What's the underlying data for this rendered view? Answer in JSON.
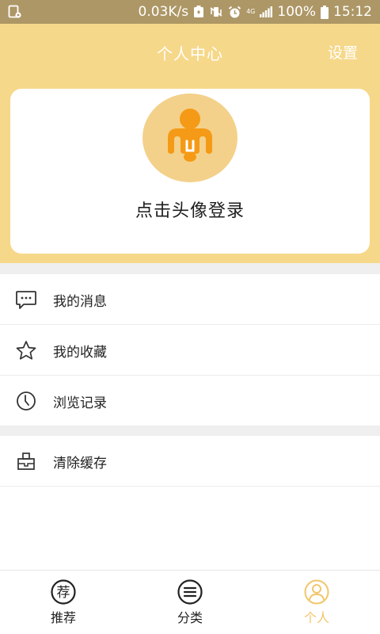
{
  "status_bar": {
    "speed": "0.03K/s",
    "network": "4G",
    "battery": "100%",
    "time": "15:12"
  },
  "header": {
    "title": "个人中心",
    "settings": "设置"
  },
  "profile": {
    "login_prompt": "点击头像登录"
  },
  "menu": {
    "group1": [
      {
        "label": "我的消息",
        "icon": "message-icon"
      },
      {
        "label": "我的收藏",
        "icon": "star-icon"
      },
      {
        "label": "浏览记录",
        "icon": "clock-icon"
      }
    ],
    "group2": [
      {
        "label": "清除缓存",
        "icon": "broom-icon"
      }
    ]
  },
  "tabbar": {
    "tabs": [
      {
        "label": "推荐",
        "icon_text": "荐",
        "active": false
      },
      {
        "label": "分类",
        "active": false
      },
      {
        "label": "个人",
        "active": true
      }
    ]
  },
  "colors": {
    "header_bg": "#f6d88a",
    "status_bg": "#ad9766",
    "avatar_bg": "#f3d18a",
    "accent_orange": "#f59a16",
    "active_tab": "#f2c66b"
  }
}
